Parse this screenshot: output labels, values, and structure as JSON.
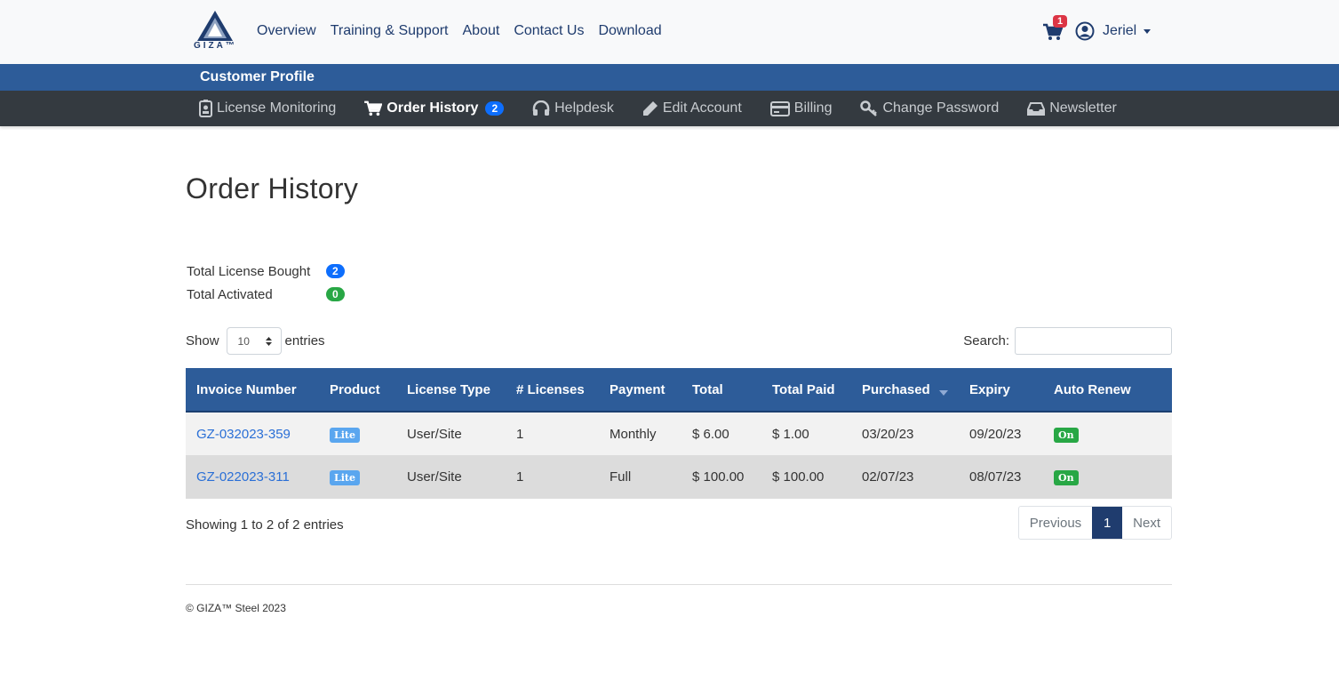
{
  "brand": {
    "logo_text": "GIZA™"
  },
  "topnav": {
    "items": [
      "Overview",
      "Training & Support",
      "About",
      "Contact Us",
      "Download"
    ],
    "cart_count": "1",
    "user": "Jeriel"
  },
  "profile": {
    "title": "Customer Profile"
  },
  "subnav": {
    "items": [
      {
        "label": "License Monitoring",
        "icon": "id-badge-icon"
      },
      {
        "label": "Order History",
        "icon": "cart-icon",
        "badge": "2"
      },
      {
        "label": "Helpdesk",
        "icon": "headset-icon"
      },
      {
        "label": "Edit Account",
        "icon": "pencil-icon"
      },
      {
        "label": "Billing",
        "icon": "credit-card-icon"
      },
      {
        "label": "Change Password",
        "icon": "key-icon"
      },
      {
        "label": "Newsletter",
        "icon": "inbox-icon"
      }
    ]
  },
  "page": {
    "title": "Order History",
    "stats": [
      {
        "label": "Total License Bought",
        "value": "2"
      },
      {
        "label": "Total Activated",
        "value": "0"
      }
    ],
    "show_label": "Show",
    "entries_label": "entries",
    "page_size": "10",
    "search_label": "Search:",
    "search_value": ""
  },
  "table": {
    "headers": [
      "Invoice Number",
      "Product",
      "License Type",
      "# Licenses",
      "Payment",
      "Total",
      "Total Paid",
      "Purchased",
      "Expiry",
      "Auto Renew"
    ],
    "rows": [
      {
        "invoice": "GZ-032023-359",
        "product": "Lite",
        "license_type": "User/Site",
        "licenses": "1",
        "payment": "Monthly",
        "total": "$ 6.00",
        "paid": "$ 1.00",
        "purchased": "03/20/23",
        "expiry": "09/20/23",
        "renew": "On"
      },
      {
        "invoice": "GZ-022023-311",
        "product": "Lite",
        "license_type": "User/Site",
        "licenses": "1",
        "payment": "Full",
        "total": "$ 100.00",
        "paid": "$ 100.00",
        "purchased": "02/07/23",
        "expiry": "08/07/23",
        "renew": "On"
      }
    ]
  },
  "pagination": {
    "info": "Showing 1 to 2 of 2 entries",
    "previous": "Previous",
    "current": "1",
    "next": "Next"
  },
  "footer": {
    "copyright": "© GIZA™ Steel 2023"
  },
  "colors": {
    "primary": "#2d5c99",
    "dark_nav": "#343a40",
    "link": "#2a6fd6",
    "badge_red": "#dc3545",
    "badge_blue": "#0d6efd",
    "badge_green": "#28a745"
  }
}
